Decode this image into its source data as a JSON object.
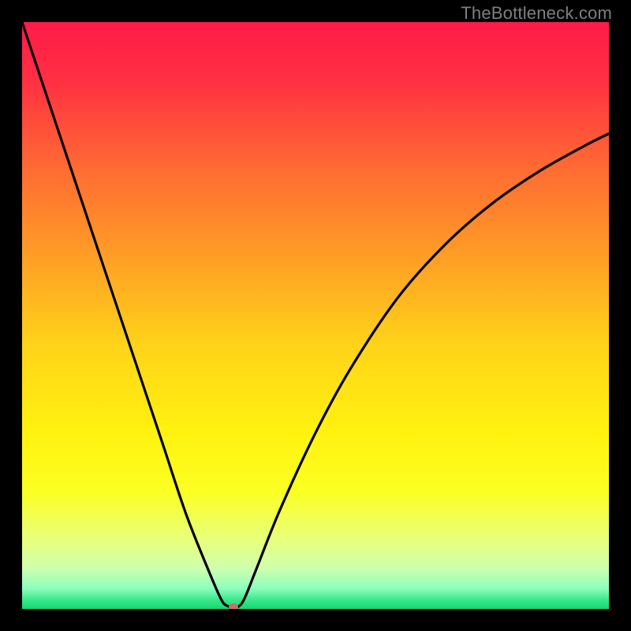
{
  "watermark": "TheBottleneck.com",
  "colors": {
    "frame": "#000000",
    "curve": "#000000",
    "marker": "#cb6e67",
    "watermark_text": "#7f7f7f",
    "gradient_stops": [
      {
        "offset": 0.0,
        "color": "#ff1b49"
      },
      {
        "offset": 0.1,
        "color": "#ff3042"
      },
      {
        "offset": 0.25,
        "color": "#ff6b33"
      },
      {
        "offset": 0.4,
        "color": "#ff9e25"
      },
      {
        "offset": 0.55,
        "color": "#ffd319"
      },
      {
        "offset": 0.7,
        "color": "#fff20f"
      },
      {
        "offset": 0.8,
        "color": "#fbff22"
      },
      {
        "offset": 0.88,
        "color": "#e9ff7a"
      },
      {
        "offset": 0.93,
        "color": "#cfffad"
      },
      {
        "offset": 0.965,
        "color": "#8dffbf"
      },
      {
        "offset": 0.985,
        "color": "#35e98a"
      },
      {
        "offset": 1.0,
        "color": "#17d670"
      }
    ]
  },
  "chart_data": {
    "type": "line",
    "title": "",
    "xlabel": "",
    "ylabel": "",
    "xlim": [
      0,
      100
    ],
    "ylim": [
      0,
      100
    ],
    "series": [
      {
        "name": "bottleneck-curve",
        "x": [
          0,
          4,
          8,
          12,
          16,
          20,
          24,
          28,
          32,
          34,
          35,
          36,
          37,
          38,
          40,
          44,
          50,
          56,
          64,
          72,
          80,
          88,
          96,
          100
        ],
        "y": [
          100,
          88,
          76,
          64,
          52,
          40,
          28,
          16,
          6,
          1.5,
          0.5,
          0.3,
          0.5,
          2,
          7,
          17,
          30,
          41,
          53,
          62,
          69,
          74.5,
          79,
          81
        ]
      }
    ],
    "marker": {
      "x": 36,
      "y": 0.3
    }
  }
}
